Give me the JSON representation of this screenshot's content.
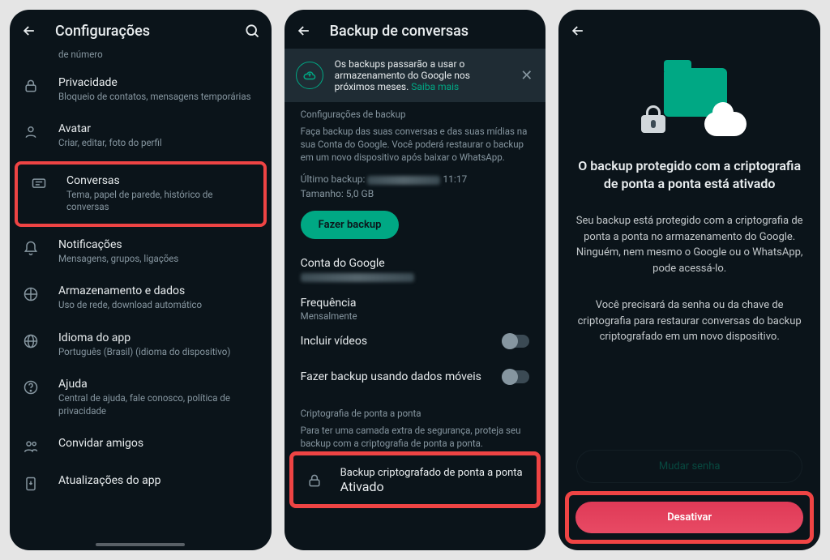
{
  "screen1": {
    "title": "Configurações",
    "truncated_top": "de número",
    "items": [
      {
        "title": "Privacidade",
        "sub": "Bloqueio de contatos, mensagens temporárias",
        "icon": "lock-icon"
      },
      {
        "title": "Avatar",
        "sub": "Criar, editar, foto do perfil",
        "icon": "avatar-icon"
      },
      {
        "title": "Conversas",
        "sub": "Tema, papel de parede, histórico de conversas",
        "icon": "chat-icon",
        "highlight": true
      },
      {
        "title": "Notificações",
        "sub": "Mensagens, grupos, ligações",
        "icon": "bell-icon"
      },
      {
        "title": "Armazenamento e dados",
        "sub": "Uso de rede, download automático",
        "icon": "data-icon"
      },
      {
        "title": "Idioma do app",
        "sub": "Português (Brasil) (idioma do dispositivo)",
        "icon": "globe-icon"
      },
      {
        "title": "Ajuda",
        "sub": "Central de ajuda, fale conosco, política de privacidade",
        "icon": "help-icon"
      },
      {
        "title": "Convidar amigos",
        "sub": "",
        "icon": "invite-icon"
      },
      {
        "title": "Atualizações do app",
        "sub": "",
        "icon": "update-icon"
      }
    ]
  },
  "screen2": {
    "title": "Backup de conversas",
    "banner_text": "Os backups passarão a usar o armazenamento do Google nos próximos meses. ",
    "banner_link": "Saiba mais",
    "section_config": "Configurações de backup",
    "intro": "Faça backup das suas conversas e das suas mídias na sua Conta do Google. Você poderá restaurar o backup em um novo dispositivo após baixar o WhatsApp.",
    "last_backup_label": "Último backup:",
    "last_backup_time": "11:17",
    "size_label": "Tamanho:",
    "size_value": "5,0 GB",
    "backup_btn": "Fazer backup",
    "google_account": "Conta do Google",
    "frequency_label": "Frequência",
    "frequency_value": "Mensalmente",
    "include_videos": "Incluir vídeos",
    "mobile_data": "Fazer backup usando dados móveis",
    "e2e_section": "Criptografia de ponta a ponta",
    "e2e_hint": "Para ter uma camada extra de segurança, proteja seu backup com a criptografia de ponta a ponta.",
    "e2e_item_title": "Backup criptografado de ponta a ponta",
    "e2e_item_sub": "Ativado"
  },
  "screen3": {
    "heading": "O backup protegido com a criptografia de ponta a ponta está ativado",
    "para1": "Seu backup está protegido com a criptografia de ponta a ponta no armazenamento do Google. Ninguém, nem mesmo o Google ou o WhatsApp, pode acessá-lo.",
    "para2": "Você precisará da senha ou da chave de criptografia para restaurar conversas do backup criptografado em um novo dispositivo.",
    "change_pw": "Mudar senha",
    "disable": "Desativar"
  }
}
